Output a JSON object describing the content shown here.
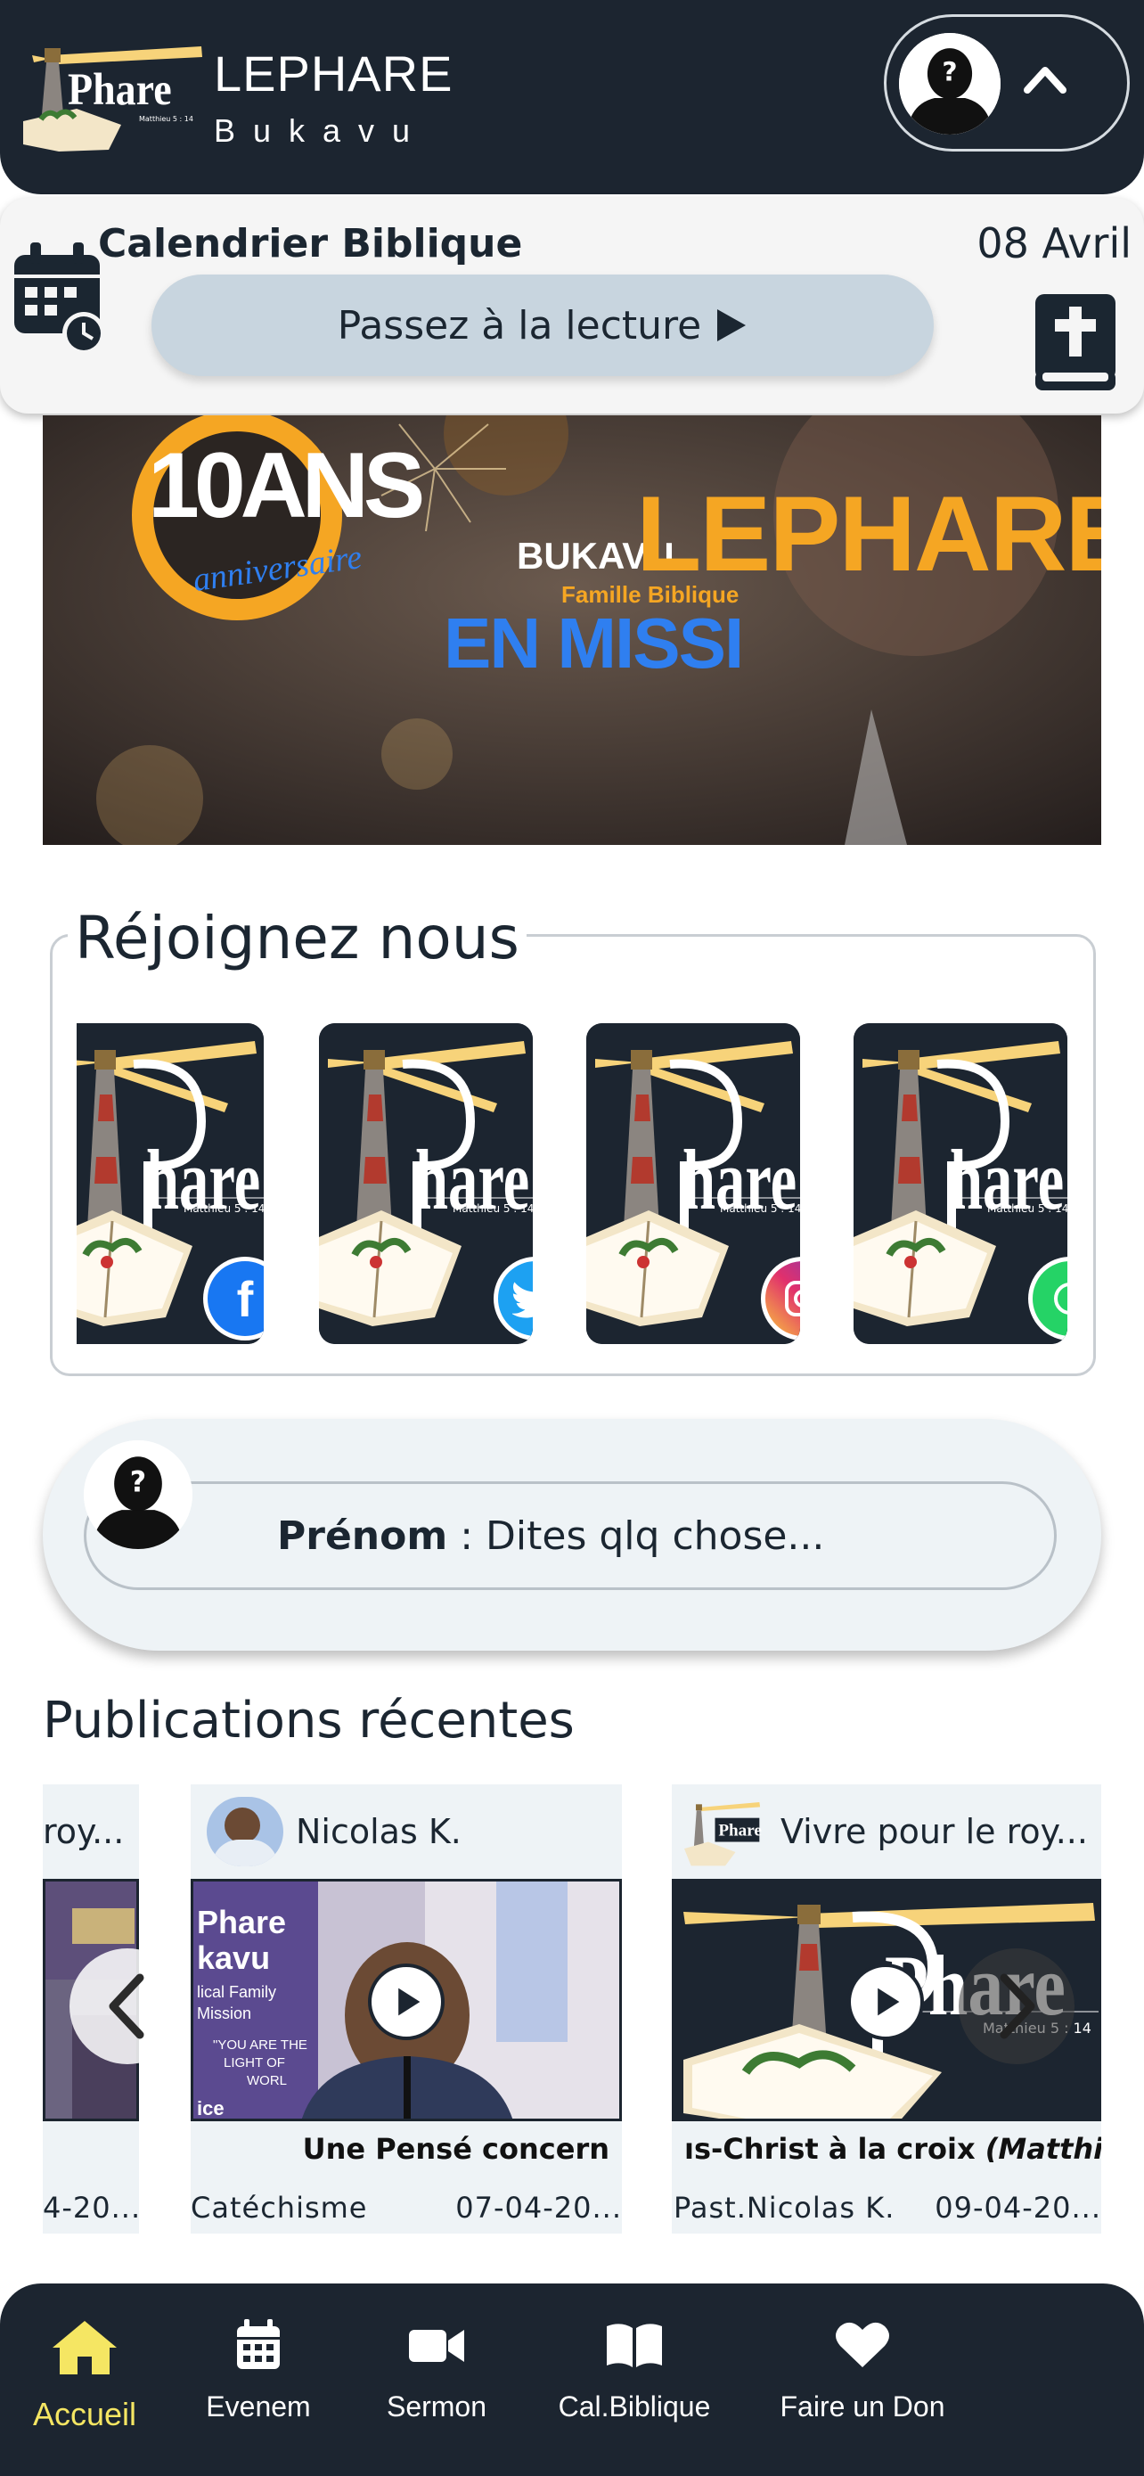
{
  "header": {
    "app_title": "LEPHARE",
    "app_subtitle": "Bukavu",
    "logo_word": "Phare",
    "logo_verse": "Matthieu 5 : 14"
  },
  "calendar": {
    "title": "Calendrier Biblique",
    "date": "08 Avril",
    "read_button": "Passez à la lecture"
  },
  "banner": {
    "years": "10ANS",
    "anniversary": "anniversaire",
    "city": "BUKAVU",
    "brand": "LEPHARE",
    "tagline": "Famille Biblique",
    "mission": "EN MISSI"
  },
  "join": {
    "title": "Réjoignez nous",
    "cards": [
      {
        "network": "facebook",
        "icon": "facebook-icon",
        "color": "#1877f2",
        "badge_glyph": "f"
      },
      {
        "network": "twitter",
        "icon": "twitter-icon",
        "color": "#1da1f2",
        "badge_glyph": ""
      },
      {
        "network": "instagram",
        "icon": "instagram-icon",
        "color": "#e1306c",
        "badge_glyph": ""
      },
      {
        "network": "whatsapp",
        "icon": "whatsapp-icon",
        "color": "#25d366",
        "badge_glyph": ""
      }
    ]
  },
  "comment": {
    "name_label": "Prénom",
    "separator": ":",
    "placeholder": "Dites qlq chose..."
  },
  "publications": {
    "title": "Publications récentes",
    "items": [
      {
        "author": "roy...",
        "caption": "",
        "category": "",
        "date": "4-20..."
      },
      {
        "author": "Nicolas K.",
        "caption": "Une Pensé concern",
        "category": "Catéchisme",
        "date": "07-04-20..."
      },
      {
        "author": "Vivre pour le roy...",
        "caption": "ıs-Christ à la croix",
        "caption_ref": "(Matthie",
        "category": "Past.Nicolas K.",
        "date": "09-04-20..."
      }
    ],
    "thumb_text": {
      "phare": "Phare",
      "kavu": "kavu",
      "family": "lical Family",
      "mission": "Mission",
      "quote1": "\"YOU ARE THE",
      "quote2": "LIGHT OF",
      "quote3": "WORL",
      "service": "ice"
    }
  },
  "nav": {
    "items": [
      {
        "label": "Accueil",
        "icon": "home-icon",
        "active": true
      },
      {
        "label": "Evenem",
        "icon": "calendar-icon",
        "active": false
      },
      {
        "label": "Sermon",
        "icon": "video-camera-icon",
        "active": false
      },
      {
        "label": "Cal.Biblique",
        "icon": "open-book-icon",
        "active": false
      },
      {
        "label": "Faire un Don",
        "icon": "heart-icon",
        "active": false
      }
    ]
  },
  "colors": {
    "primary_dark": "#1c2530",
    "active_nav": "#f5e663",
    "read_button_bg": "#c8d5df",
    "banner_orange": "#f5a623",
    "banner_blue": "#2f7ff0"
  }
}
